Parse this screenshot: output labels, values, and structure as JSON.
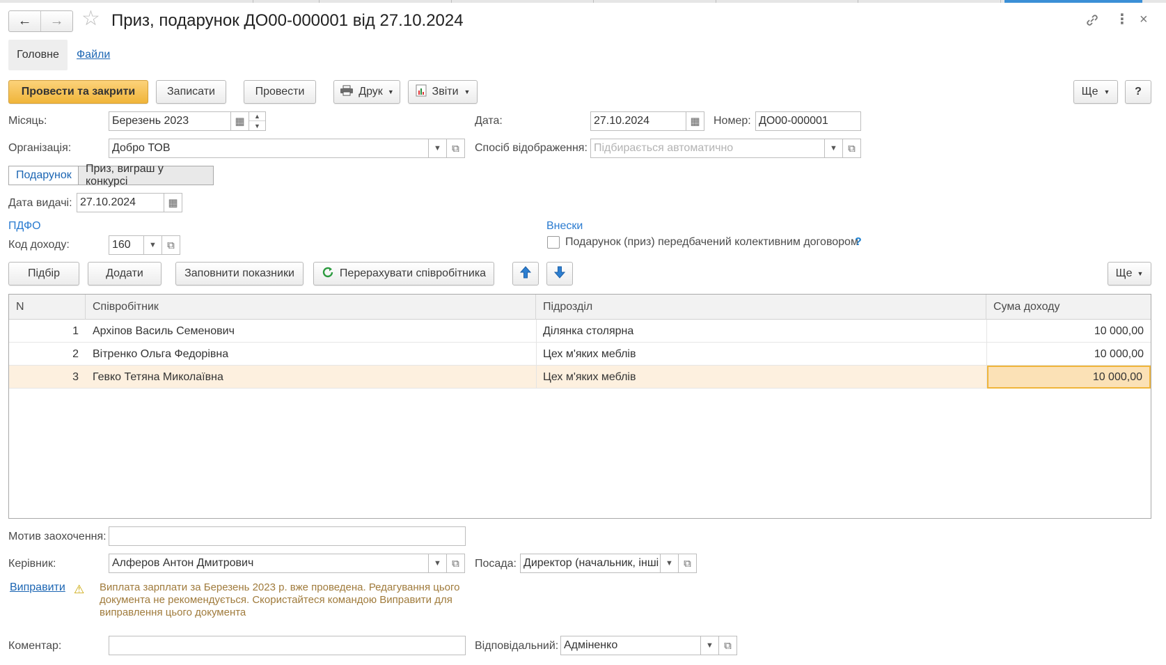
{
  "window": {
    "title": "Приз, подарунок ДО00-000001 від 27.10.2024",
    "nav_back": "←",
    "nav_forward": "→",
    "close_glyph": "×"
  },
  "tabs": {
    "main": "Головне",
    "files": "Файли"
  },
  "toolbar": {
    "post_and_close": "Провести та закрити",
    "save": "Записати",
    "post": "Провести",
    "print": "Друк",
    "reports": "Звіти",
    "more": "Ще",
    "help": "?"
  },
  "form": {
    "month_label": "Місяць:",
    "month_value": "Березень 2023",
    "date_label": "Дата:",
    "date_value": "27.10.2024",
    "number_label": "Номер:",
    "number_value": "ДО00-000001",
    "org_label": "Організація:",
    "org_value": "Добро ТОВ",
    "display_label": "Спосіб відображення:",
    "display_placeholder": "Підбирається автоматично",
    "segment_gift": "Подарунок",
    "segment_prize": "Приз, виграш у конкурсі",
    "issue_date_label": "Дата видачі:",
    "issue_date_value": "27.10.2024",
    "pdfo_section": "ПДФО",
    "income_code_label": "Код доходу:",
    "income_code_value": "160",
    "contrib_section": "Внески",
    "collective_checkbox_label": "Подарунок (приз) передбачений колективним договором",
    "collective_checked": false,
    "help_mark": "?"
  },
  "table_toolbar": {
    "pick": "Підбір",
    "add": "Додати",
    "fill": "Заповнити показники",
    "recalc": "Перерахувати співробітника",
    "more": "Ще"
  },
  "table": {
    "columns": [
      "N",
      "Співробітник",
      "Підрозділ",
      "Сума доходу"
    ],
    "rows": [
      {
        "n": "1",
        "employee": "Архіпов Василь Семенович",
        "dept": "Ділянка столярна",
        "sum": "10 000,00"
      },
      {
        "n": "2",
        "employee": "Вітренко Ольга Федорівна",
        "dept": "Цех м'яких меблів",
        "sum": "10 000,00"
      },
      {
        "n": "3",
        "employee": "Гевко Тетяна Миколаївна",
        "dept": "Цех м'яких меблів",
        "sum": "10 000,00"
      }
    ],
    "selected_row": 3
  },
  "footer": {
    "motive_label": "Мотив заохочення:",
    "motive_value": "",
    "head_label": "Керівник:",
    "head_value": "Алферов Антон Дмитрович",
    "position_label": "Посада:",
    "position_value": "Директор (начальник, інші",
    "fix_link": "Виправити",
    "warning_text": "Виплата зарплати за Березень 2023 р. вже проведена. Редагування цього документа не рекомендується. Скористайтеся командою Виправити для виправлення цього документа",
    "comment_label": "Коментар:",
    "comment_value": "",
    "responsible_label": "Відповідальний:",
    "responsible_value": "Адміненко"
  },
  "colors": {
    "primary_button": "#f0b53a",
    "link": "#1b65b3",
    "section": "#2a7bd0",
    "selected_row": "#fdf0df",
    "warning_text": "#a07b3c"
  }
}
